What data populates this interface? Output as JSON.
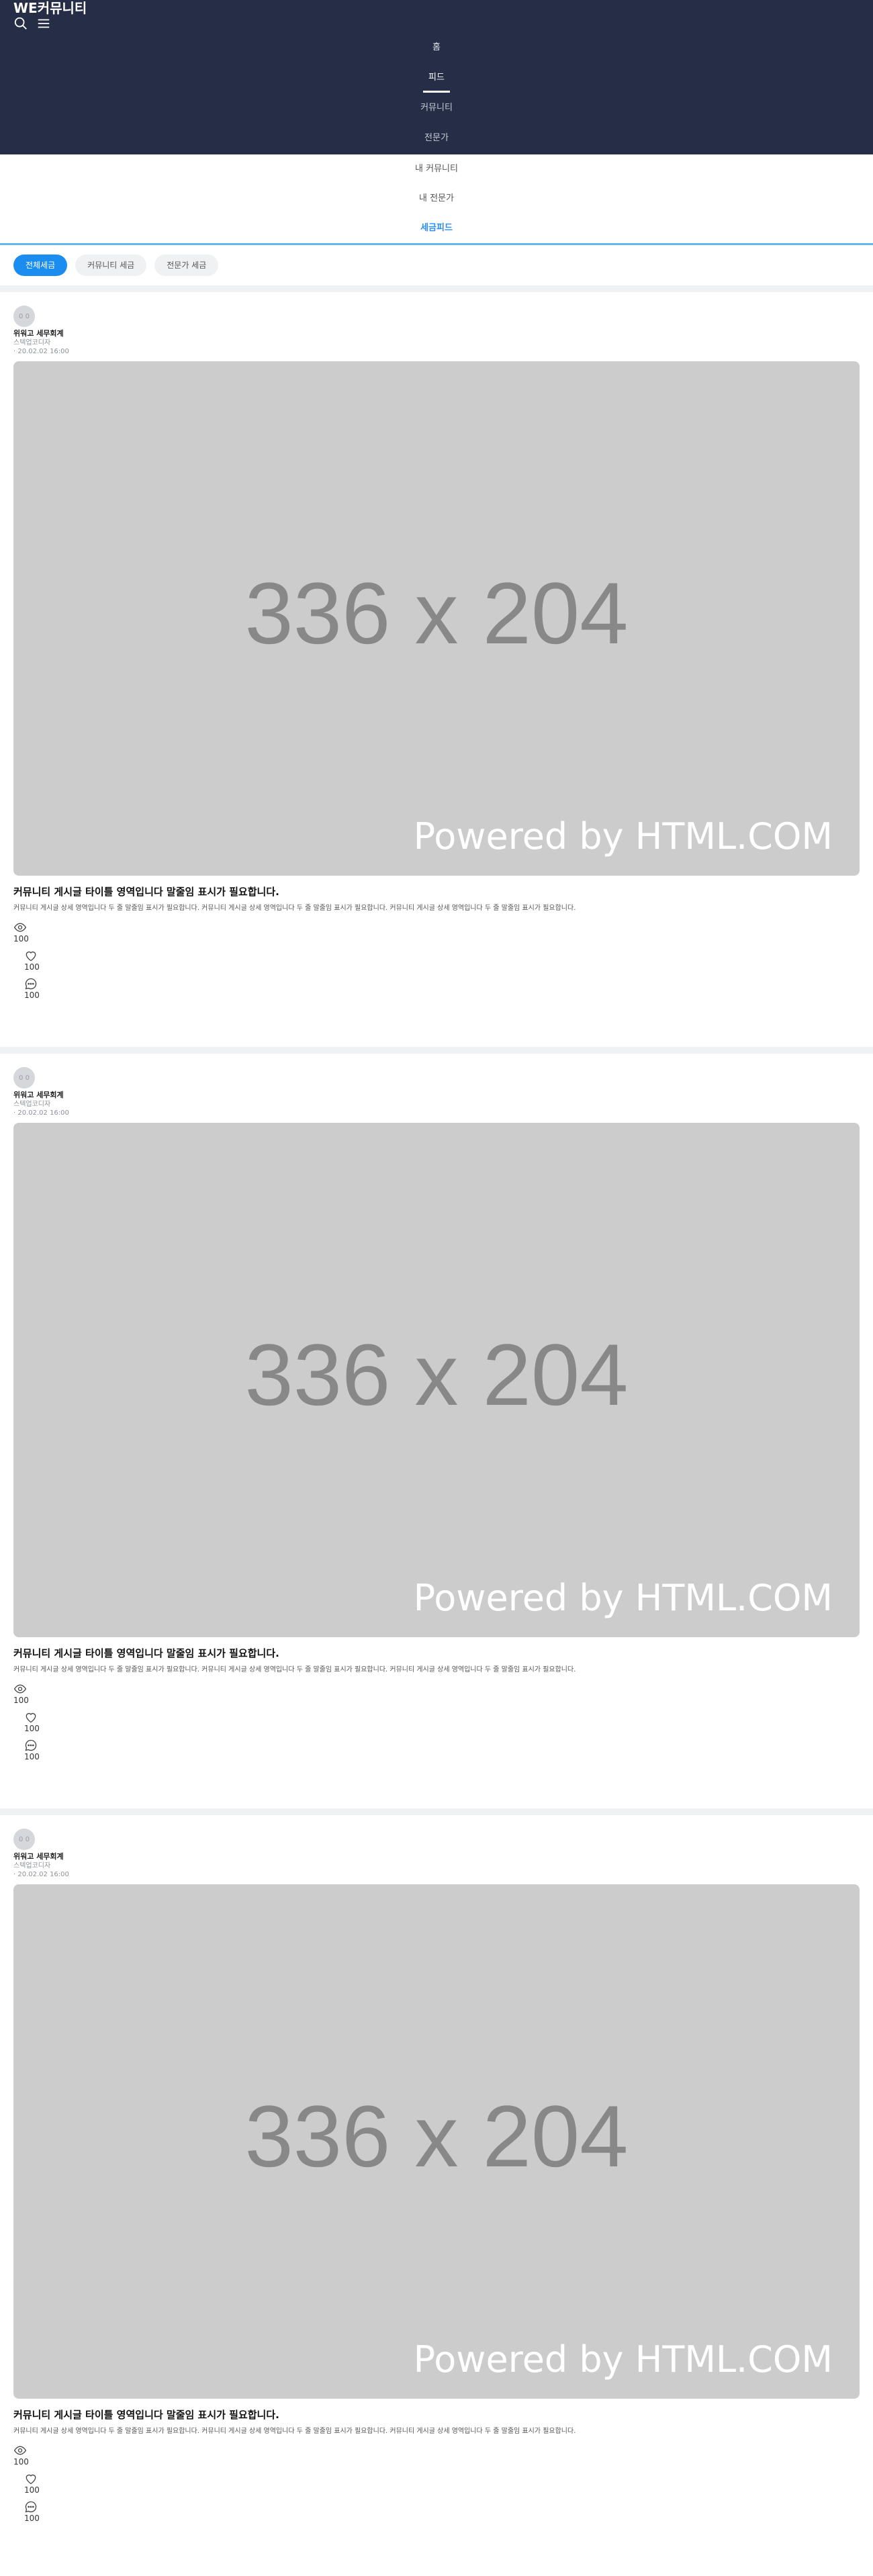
{
  "app": {
    "brand": "WE커뮤니티"
  },
  "nav": {
    "home": "홈",
    "feed": "피드",
    "community": "커뮤니티",
    "expert": "전문가"
  },
  "subnav": {
    "my_community": "내 커뮤니티",
    "my_expert": "내 전문가",
    "tax_feed": "세금피드"
  },
  "filters": [
    "전체세금",
    "커뮤니티 세금",
    "전문가 세금"
  ],
  "posts": [
    {
      "avatar_text": "0 0",
      "author": "위워고 세무회계",
      "role": "스텍업코디자",
      "date": "· 20.02.02 16:00",
      "image_dim": "336 x 204",
      "image_watermark": "Powered by HTML.COM",
      "title": "커뮤니티 게시글 타이틀 영역입니다 말줄임 표시가 필요합니다.",
      "body": "커뮤니티 게시글 상세 영역입니다 두 줄 말줄임 표시가 필요합니다. 커뮤니티 게시글 상세 영역입니다 두 줄 말줄임 표시가 필요합니다. 커뮤니티 게시글 상세 영역입니다 두 줄 말줄임 표시가 필요합니다.",
      "views": "100",
      "likes": "100",
      "comments": "100"
    },
    {
      "avatar_text": "0 0",
      "author": "위워고 세무회계",
      "role": "스텍업코디자",
      "date": "· 20.02.02 16:00",
      "image_dim": "336 x 204",
      "image_watermark": "Powered by HTML.COM",
      "title": "커뮤니티 게시글 타이틀 영역입니다 말줄임 표시가 필요합니다.",
      "body": "커뮤니티 게시글 상세 영역입니다 두 줄 말줄임 표시가 필요합니다. 커뮤니티 게시글 상세 영역입니다 두 줄 말줄임 표시가 필요합니다. 커뮤니티 게시글 상세 영역입니다 두 줄 말줄임 표시가 필요합니다.",
      "views": "100",
      "likes": "100",
      "comments": "100"
    },
    {
      "avatar_text": "0 0",
      "author": "위워고 세무회계",
      "role": "스텍업코디자",
      "date": "· 20.02.02 16:00",
      "image_dim": "336 x 204",
      "image_watermark": "Powered by HTML.COM",
      "title": "커뮤니티 게시글 타이틀 영역입니다 말줄임 표시가 필요합니다.",
      "body": "커뮤니티 게시글 상세 영역입니다 두 줄 말줄임 표시가 필요합니다. 커뮤니티 게시글 상세 영역입니다 두 줄 말줄임 표시가 필요합니다. 커뮤니티 게시글 상세 영역입니다 두 줄 말줄임 표시가 필요합니다.",
      "views": "100",
      "likes": "100",
      "comments": "100"
    }
  ]
}
